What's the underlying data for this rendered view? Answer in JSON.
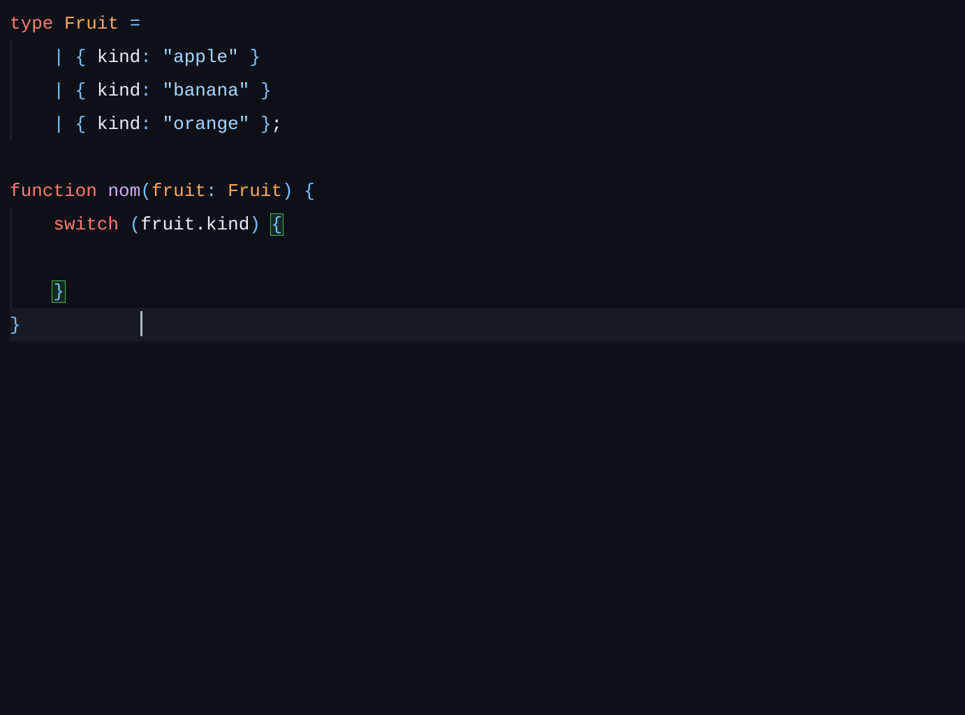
{
  "code": {
    "line1": {
      "kw_type": "type",
      "type_name": "Fruit",
      "equals": "="
    },
    "line2": {
      "indent": "    ",
      "pipe": "|",
      "lcurl": "{",
      "kind": "kind",
      "colon": ":",
      "value": "\"apple\"",
      "rcurl": "}"
    },
    "line3": {
      "indent": "    ",
      "pipe": "|",
      "lcurl": "{",
      "kind": "kind",
      "colon": ":",
      "value": "\"banana\"",
      "rcurl": "}"
    },
    "line4": {
      "indent": "    ",
      "pipe": "|",
      "lcurl": "{",
      "kind": "kind",
      "colon": ":",
      "value": "\"orange\"",
      "rcurl": "}",
      "semi": ";"
    },
    "line6": {
      "kw_func": "function",
      "name": "nom",
      "lparen": "(",
      "param": "fruit",
      "colon": ":",
      "type": "Fruit",
      "rparen": ")",
      "lcurl": "{"
    },
    "line7": {
      "indent": "    ",
      "kw": "switch",
      "lparen": "(",
      "var": "fruit",
      "dot": ".",
      "prop": "kind",
      "rparen": ")",
      "lcurl": "{"
    },
    "line8": {
      "indent": "        "
    },
    "line9": {
      "indent": "    ",
      "rcurl": "}"
    },
    "line10": {
      "rcurl": "}"
    }
  }
}
